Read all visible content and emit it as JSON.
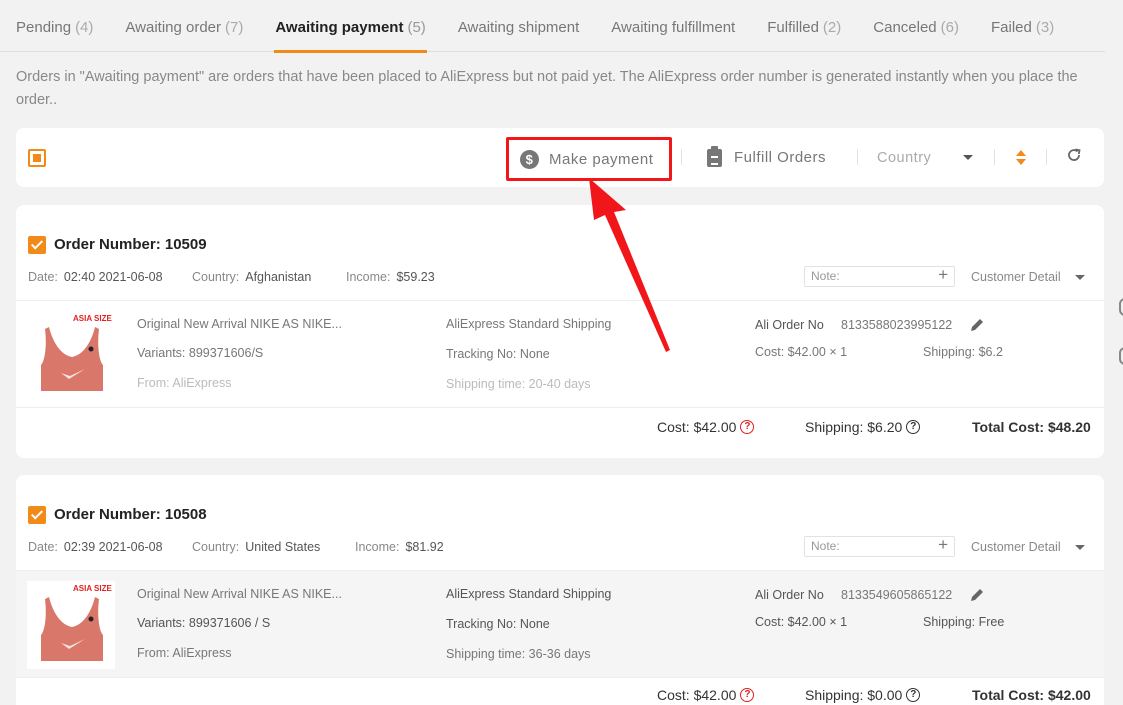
{
  "tabs": [
    {
      "label": "Pending",
      "count": "(4)"
    },
    {
      "label": "Awaiting order",
      "count": "(7)"
    },
    {
      "label": "Awaiting payment",
      "count": "(5)"
    },
    {
      "label": "Awaiting shipment",
      "count": ""
    },
    {
      "label": "Awaiting fulfillment",
      "count": ""
    },
    {
      "label": "Fulfilled",
      "count": "(2)"
    },
    {
      "label": "Canceled",
      "count": "(6)"
    },
    {
      "label": "Failed",
      "count": "(3)"
    }
  ],
  "description": "Orders in \"Awaiting payment\" are orders that have been placed to AliExpress but not paid yet. The AliExpress order number is generated instantly when you place the order..",
  "toolbar": {
    "make_payment": "Make payment",
    "fulfill_orders": "Fulfill Orders",
    "country_placeholder": "Country",
    "coin_symbol": "$"
  },
  "labels": {
    "date": "Date:",
    "country": "Country:",
    "income": "Income:",
    "note": "Note:",
    "customer_detail": "Customer Detail",
    "ali_order_no": "Ali Order No",
    "thumb_size": "ASIA SIZE"
  },
  "orders": [
    {
      "order_number": "Order Number: 10509",
      "date": "02:40 2021-06-08",
      "country": "Afghanistan",
      "income": "$59.23",
      "product_title": "Original New Arrival NIKE AS NIKE...",
      "variants": "Variants: 899371606/S",
      "from": "From: AliExpress",
      "shipping_method": "AliExpress Standard Shipping",
      "tracking": "Tracking No: None",
      "shipping_time": "Shipping time: 20-40 days",
      "ali_order_no": "8133588023995122",
      "item_cost": "Cost: $42.00 × 1",
      "item_shipping": "Shipping: $6.2",
      "cost": "Cost: $42.00",
      "shipping": "Shipping: $6.20",
      "total": "Total Cost: $48.20"
    },
    {
      "order_number": "Order Number: 10508",
      "date": "02:39 2021-06-08",
      "country": "United States",
      "income": "$81.92",
      "product_title": "Original New Arrival NIKE AS NIKE...",
      "variants": "Variants: 899371606 / S",
      "from": "From: AliExpress",
      "shipping_method": "AliExpress Standard Shipping",
      "tracking": "Tracking No: None",
      "shipping_time": "Shipping time: 36-36 days",
      "ali_order_no": "8133549605865122",
      "item_cost": "Cost: $42.00 × 1",
      "item_shipping": "Shipping: Free",
      "cost": "Cost: $42.00",
      "shipping": "Shipping: $0.00",
      "total": "Total Cost: $42.00"
    }
  ],
  "colors": {
    "accent": "#f28a19",
    "highlight": "#f0161a"
  }
}
